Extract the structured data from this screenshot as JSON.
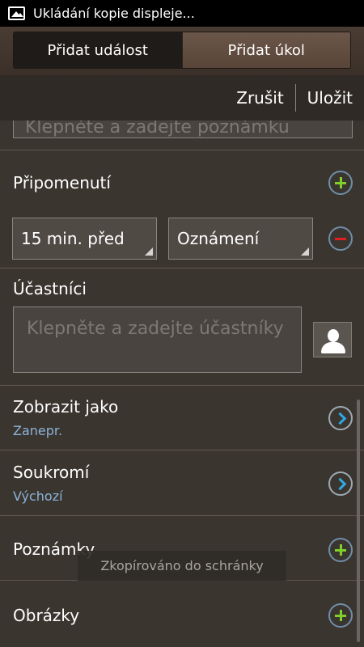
{
  "status_bar": {
    "text": "Ukládání kopie displeje...",
    "icon": "image-icon"
  },
  "tabs": [
    {
      "label": "Přidat událost",
      "selected": true
    },
    {
      "label": "Přidat úkol",
      "selected": false
    }
  ],
  "actions": {
    "cancel_label": "Zrušit",
    "save_label": "Uložit"
  },
  "note": {
    "placeholder": "Klepněte a zadejte poznámku"
  },
  "reminder": {
    "title": "Připomenutí",
    "time_value": "15 min. před",
    "type_value": "Oznámení"
  },
  "participants": {
    "title": "Účastníci",
    "placeholder": "Klepněte a zadejte účastníky"
  },
  "show_as": {
    "title": "Zobrazit jako",
    "value": "Zanepr."
  },
  "privacy": {
    "title": "Soukromí",
    "value": "Výchozí"
  },
  "notes": {
    "title": "Poznámky"
  },
  "images": {
    "title": "Obrázky"
  },
  "toast": {
    "text": "Zkopírováno do schránky"
  },
  "colors": {
    "accent_green": "#7fd129",
    "accent_red": "#e02020",
    "accent_blue": "#2ea8e6",
    "sub_text": "#8bb3d9"
  }
}
